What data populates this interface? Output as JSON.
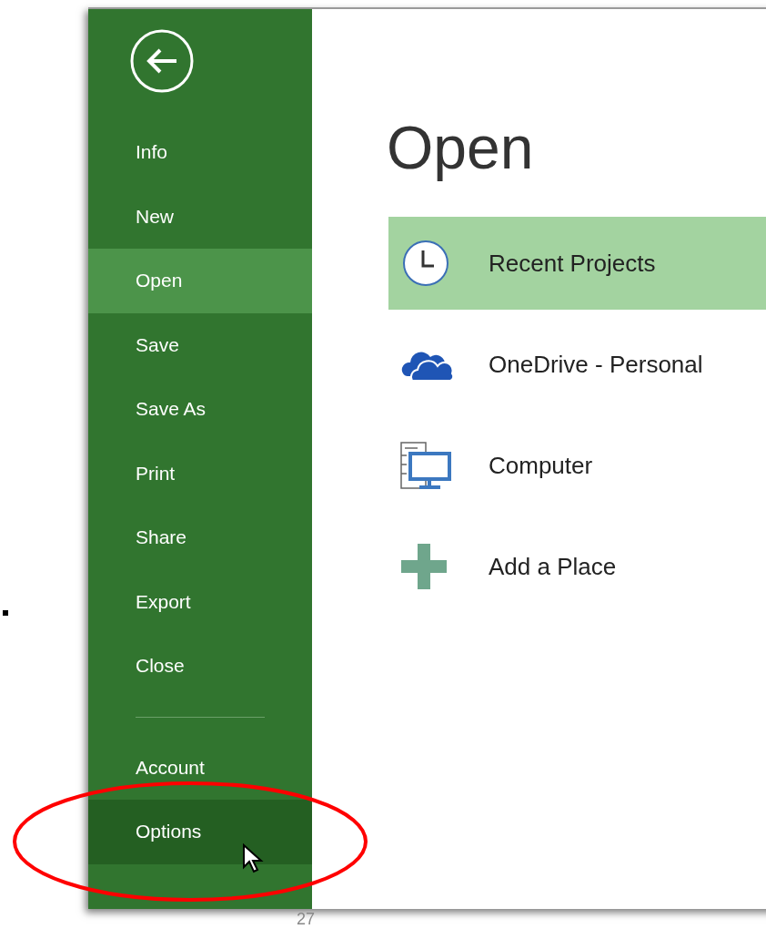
{
  "sidebar": {
    "items": [
      {
        "label": "Info",
        "selected": false,
        "hovered": false
      },
      {
        "label": "New",
        "selected": false,
        "hovered": false
      },
      {
        "label": "Open",
        "selected": true,
        "hovered": false
      },
      {
        "label": "Save",
        "selected": false,
        "hovered": false
      },
      {
        "label": "Save As",
        "selected": false,
        "hovered": false
      },
      {
        "label": "Print",
        "selected": false,
        "hovered": false
      },
      {
        "label": "Share",
        "selected": false,
        "hovered": false
      },
      {
        "label": "Export",
        "selected": false,
        "hovered": false
      },
      {
        "label": "Close",
        "selected": false,
        "hovered": false
      }
    ],
    "bottom_items": [
      {
        "label": "Account",
        "selected": false,
        "hovered": false
      },
      {
        "label": "Options",
        "selected": false,
        "hovered": true
      }
    ]
  },
  "main": {
    "title": "Open",
    "places": [
      {
        "kind": "recent",
        "label": "Recent Projects",
        "selected": true
      },
      {
        "kind": "cloud",
        "label": "OneDrive - Personal",
        "selected": false
      },
      {
        "kind": "computer",
        "label": "Computer",
        "selected": false
      },
      {
        "kind": "add",
        "label": "Add a Place",
        "selected": false
      }
    ]
  },
  "page_number": "27"
}
